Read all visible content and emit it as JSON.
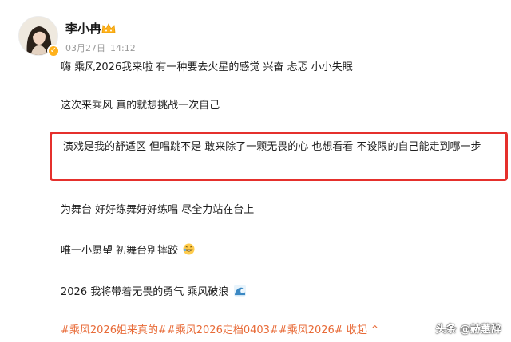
{
  "user": {
    "name": "李小冉",
    "date": "03月27日",
    "time": "14:12"
  },
  "post": {
    "line1": "嗨 乘风2026我来啦 有一种要去火星的感觉 兴奋 忐忑 小小失眠",
    "line2": "这次来乘风 真的就想挑战一次自己",
    "highlight": "演戏是我的舒适区 但唱跳不是 敢来除了一颗无畏的心 也想看看 不设限的自己能走到哪一步",
    "line3": "为舞台 好好练舞好好练唱 尽全力站在台上",
    "line4": "唯一小愿望 初舞台别摔跤",
    "line5": "2026 我将带着无畏的勇气 乘风破浪",
    "tags": "#乘风2026姐来真的##乘风2026定档0403##乘风2026# 收起 ^"
  },
  "watermark": "头条 @赫蕙辞",
  "icons": {
    "avatar": "avatar-portrait",
    "badge": "verified-badge-icon",
    "crown": "crown-icon",
    "grin": "grin-emoji-icon",
    "wave": "wave-emoji-icon"
  },
  "colors": {
    "highlight_border": "#e5302c",
    "tag_text": "#e86b38",
    "meta_text": "#9a9a9a"
  }
}
